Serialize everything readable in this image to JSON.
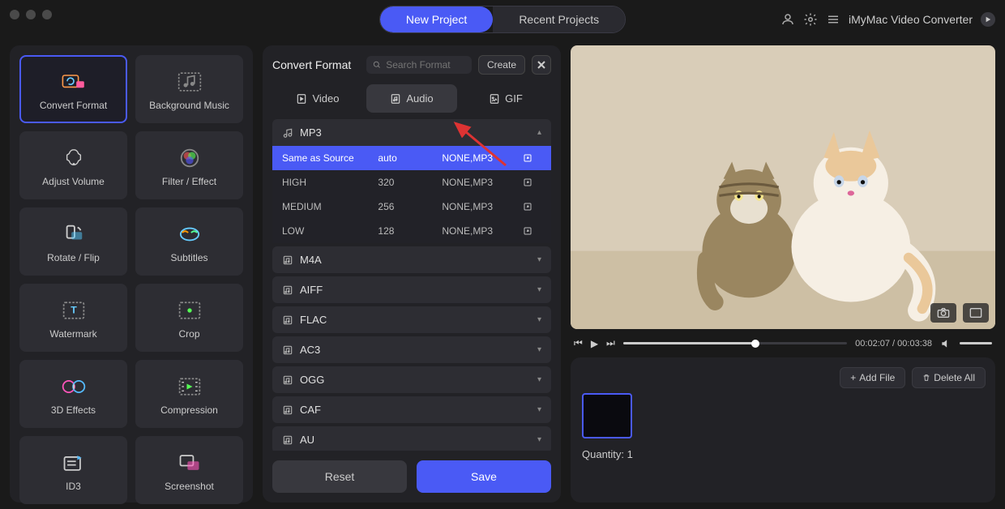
{
  "header": {
    "tabs": {
      "new_project": "New Project",
      "recent_projects": "Recent Projects"
    },
    "app_title": "iMyMac Video Converter"
  },
  "sidebar": {
    "items": [
      {
        "label": "Convert Format",
        "icon": "convert",
        "selected": true
      },
      {
        "label": "Background Music",
        "icon": "music",
        "selected": false
      },
      {
        "label": "Adjust Volume",
        "icon": "volume",
        "selected": false
      },
      {
        "label": "Filter / Effect",
        "icon": "filter",
        "selected": false
      },
      {
        "label": "Rotate / Flip",
        "icon": "rotate",
        "selected": false
      },
      {
        "label": "Subtitles",
        "icon": "subtitles",
        "selected": false
      },
      {
        "label": "Watermark",
        "icon": "watermark",
        "selected": false
      },
      {
        "label": "Crop",
        "icon": "crop",
        "selected": false
      },
      {
        "label": "3D Effects",
        "icon": "3d",
        "selected": false
      },
      {
        "label": "Compression",
        "icon": "compress",
        "selected": false
      },
      {
        "label": "ID3",
        "icon": "id3",
        "selected": false
      },
      {
        "label": "Screenshot",
        "icon": "screenshot",
        "selected": false
      }
    ]
  },
  "panel": {
    "title": "Convert Format",
    "search_placeholder": "Search Format",
    "create_label": "Create",
    "tabs": {
      "video": "Video",
      "audio": "Audio",
      "gif": "GIF"
    },
    "formats": [
      {
        "name": "MP3",
        "expanded": true,
        "qualities": [
          {
            "label": "Same as Source",
            "bitrate": "auto",
            "codec": "NONE,MP3",
            "selected": true
          },
          {
            "label": "HIGH",
            "bitrate": "320",
            "codec": "NONE,MP3",
            "selected": false
          },
          {
            "label": "MEDIUM",
            "bitrate": "256",
            "codec": "NONE,MP3",
            "selected": false
          },
          {
            "label": "LOW",
            "bitrate": "128",
            "codec": "NONE,MP3",
            "selected": false
          }
        ]
      },
      {
        "name": "M4A",
        "expanded": false
      },
      {
        "name": "AIFF",
        "expanded": false
      },
      {
        "name": "FLAC",
        "expanded": false
      },
      {
        "name": "AC3",
        "expanded": false
      },
      {
        "name": "OGG",
        "expanded": false
      },
      {
        "name": "CAF",
        "expanded": false
      },
      {
        "name": "AU",
        "expanded": false
      }
    ],
    "reset_label": "Reset",
    "save_label": "Save"
  },
  "player": {
    "current_time": "00:02:07",
    "total_time": "00:03:38"
  },
  "files": {
    "add_label": "Add File",
    "delete_label": "Delete All",
    "quantity_label": "Quantity: 1"
  }
}
